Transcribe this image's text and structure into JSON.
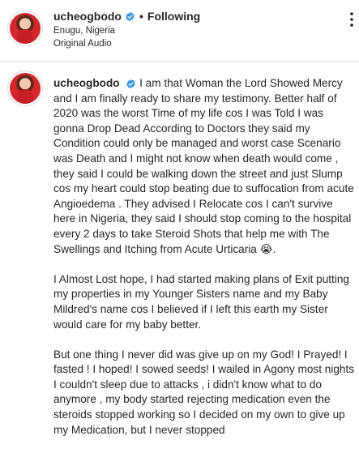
{
  "header": {
    "username": "ucheogbodo",
    "separator": "•",
    "follow_status": "Following",
    "location": "Enugu, Nigeria",
    "audio": "Original Audio",
    "verified_color": "#3897f0"
  },
  "caption": {
    "username": "ucheogbodo",
    "paragraphs": [
      "I am that Woman the Lord Showed Mercy and I am finally ready to share my testimony. Better half of 2020 was the worst Time of my life cos I was Told I was gonna Drop Dead According to Doctors they said my Condition could only be managed and worst case Scenario was Death and I might not know when death would come , they said I could be walking down the street and just Slump cos my heart could stop beating due to suffocation from acute Angioedema . They advised I Relocate cos I can't survive here in Nigeria, they said I should stop coming to the hospital every 2 days to take Steroid Shots that help me with The Swellings and Itching from Acute Urticaria 😭.",
      "I Almost Lost hope, I had started making plans of Exit putting my properties in my Younger Sisters name and my Baby Mildred's name cos I believed if I left this earth my Sister would care for my baby better.",
      "But one thing I never did was give up on my God! I Prayed! I fasted ! I hoped! I sowed seeds! I wailed in Agony most nights I couldn't sleep due to attacks , i didn't know what to do anymore , my body started rejecting medication even the steroids stopped working so I decided on my own to give up my Medication, but I never stopped"
    ]
  }
}
